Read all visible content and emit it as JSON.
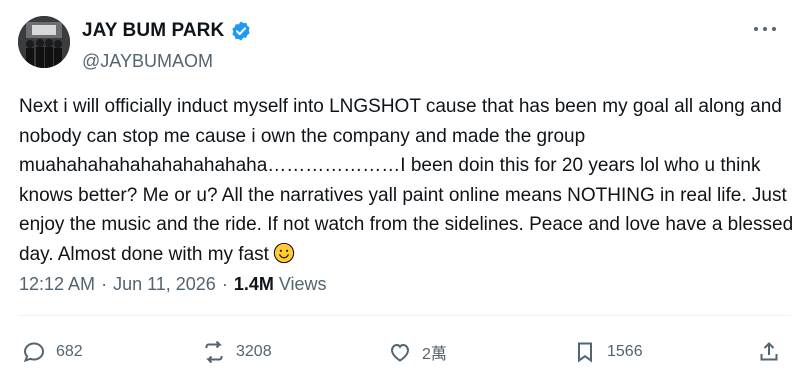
{
  "author": {
    "display_name": "JAY BUM PARK",
    "handle": "@JAYBUMAOM",
    "verified": true
  },
  "tweet": {
    "text": "Next i will officially induct myself into LNGSHOT cause that has been my goal all along and nobody can stop me cause i own the company and made the group muahahahahahahahahahaha…………………I been doin this for 20 years lol who u think knows better? Me or u? All the narratives yall paint online means NOTHING in real life. Just enjoy the music and the ride. If not watch from the sidelines. Peace and love have a blessed day. Almost done with my fast",
    "emoji": "smiling-face-icon"
  },
  "meta": {
    "time": "12:12 AM",
    "date": "Jun 11, 2026",
    "separator": "·",
    "views_count": "1.4M",
    "views_label": "Views"
  },
  "actions": {
    "replies": "682",
    "reposts": "3208",
    "likes": "2萬",
    "bookmarks": "1566"
  },
  "colors": {
    "text": "#0f1419",
    "secondary": "#536471",
    "verified_blue": "#1d9bf0",
    "emoji_yellow": "#ffcc33"
  }
}
